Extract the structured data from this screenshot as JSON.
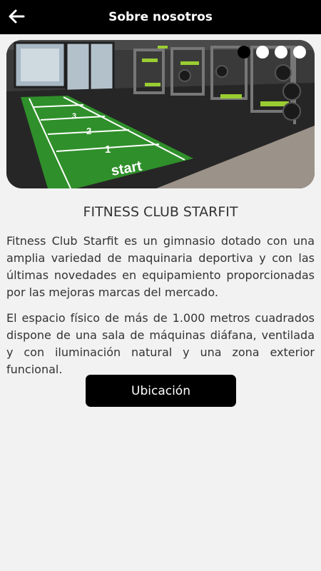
{
  "header": {
    "title": "Sobre nosotros",
    "back_icon": "arrow-left-icon"
  },
  "carousel": {
    "slide_count": 4,
    "active_index": 0,
    "turf_text": [
      "start",
      "1",
      "2",
      "3"
    ]
  },
  "about": {
    "heading": "FITNESS CLUB STARFIT",
    "paragraphs": [
      "Fitness Club Starfit es un gimnasio dotado con una amplia variedad de maquinaria deportiva y con las últimas novedades en equipamiento proporcionadas por las mejoras marcas del mercado.",
      "El espacio físico de más de 1.000 metros cuadrados dispone de una sala de máquinas diáfana, ventilada y con iluminación natural y una zona exterior funcional."
    ]
  },
  "actions": {
    "location_label": "Ubicación"
  },
  "colors": {
    "bar": "#000000",
    "background": "#f2f2f2",
    "turf": "#2f8f2a",
    "accent": "#9acd32"
  }
}
